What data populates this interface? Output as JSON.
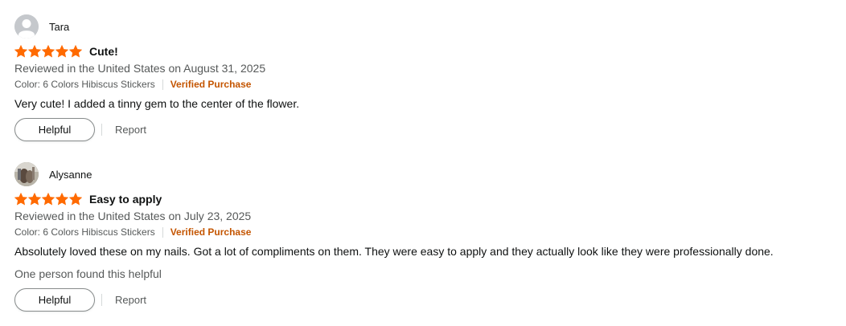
{
  "colors": {
    "star": "#ff6a00",
    "verified": "#c45500",
    "muted": "#565959"
  },
  "reviews": [
    {
      "reviewer": "Tara",
      "avatar_icon": "default-profile-icon",
      "rating": 5,
      "title": "Cute!",
      "meta": "Reviewed in the United States on August 31, 2025",
      "variant": "Color: 6 Colors Hibiscus Stickers",
      "verified": "Verified Purchase",
      "body": "Very cute! I added a tinny gem to the center of the flower.",
      "helpful_count": "",
      "helpful_label": "Helpful",
      "report_label": "Report"
    },
    {
      "reviewer": "Alysanne",
      "avatar_icon": "profile-photo",
      "rating": 5,
      "title": "Easy to apply",
      "meta": "Reviewed in the United States on July 23, 2025",
      "variant": "Color: 6 Colors Hibiscus Stickers",
      "verified": "Verified Purchase",
      "body": "Absolutely loved these on my nails. Got a lot of compliments on them. They were easy to apply and they actually look like they were professionally done.",
      "helpful_count": "One person found this helpful",
      "helpful_label": "Helpful",
      "report_label": "Report"
    }
  ]
}
